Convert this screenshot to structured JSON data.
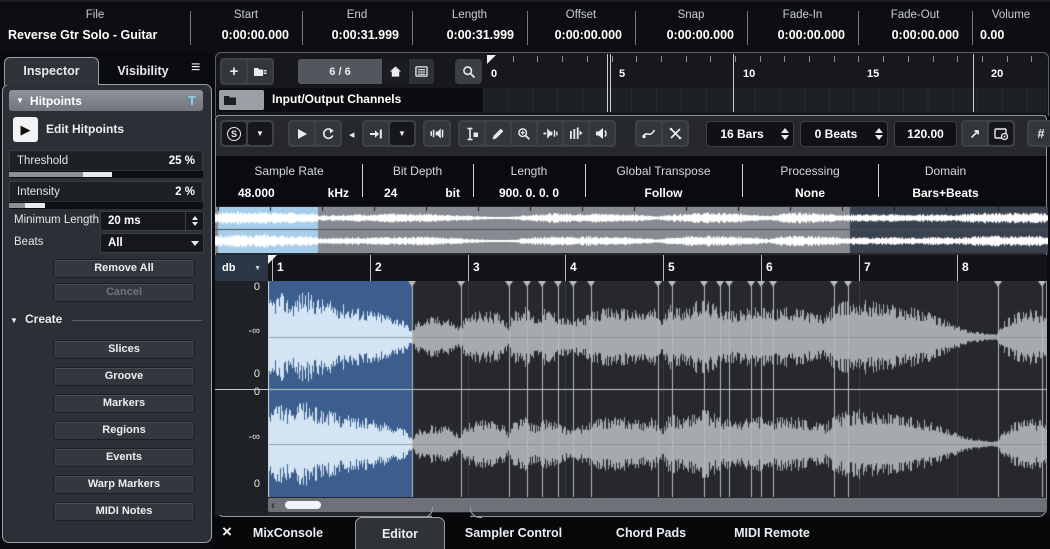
{
  "info_bar": {
    "columns": [
      {
        "label": "File",
        "value": "Reverse Gtr Solo - Guitar"
      },
      {
        "label": "Start",
        "value": "0:00:00.000"
      },
      {
        "label": "End",
        "value": "0:00:31.999"
      },
      {
        "label": "Length",
        "value": "0:00:31.999"
      },
      {
        "label": "Offset",
        "value": "0:00:00.000"
      },
      {
        "label": "Snap",
        "value": "0:00:00.000"
      },
      {
        "label": "Fade-In",
        "value": "0:00:00.000"
      },
      {
        "label": "Fade-Out",
        "value": "0:00:00.000"
      },
      {
        "label": "Volume",
        "value": "0.00"
      }
    ]
  },
  "sidebar": {
    "tabs": [
      {
        "label": "Inspector",
        "active": true
      },
      {
        "label": "Visibility",
        "active": false
      }
    ],
    "menu_icon": "≡",
    "hitpoints": {
      "collapse_icon": "▼",
      "title": "Hitpoints",
      "tool_badge": "T",
      "edit_icon": "▶",
      "edit_label": "Edit Hitpoints",
      "threshold_label": "Threshold",
      "threshold_value": "25 %",
      "threshold_fill": 0.38,
      "intensity_label": "Intensity",
      "intensity_value": "2 %",
      "intensity_fill": 0.08,
      "minimum_length_label": "Minimum Length",
      "minimum_length_value": "20 ms",
      "beats_label": "Beats",
      "beats_value": "All",
      "remove_all_label": "Remove All",
      "cancel_label": "Cancel"
    },
    "create": {
      "collapse_icon": "▼",
      "title": "Create",
      "buttons": [
        "Slices",
        "Groove",
        "Markers",
        "Regions",
        "Events",
        "Warp Markers",
        "MIDI Notes"
      ]
    }
  },
  "project_zone": {
    "track_counter": "6 / 6",
    "track_name": "Input/Output Channels",
    "ruler_ticks": [
      "0",
      "5",
      "10",
      "15",
      "20"
    ]
  },
  "editor": {
    "toolbar": {
      "solo_icon": "S",
      "dropdown_icon": "▼",
      "tiny_left_icon": "◀",
      "bars": "16 Bars",
      "beats": "0 Beats",
      "tempo": "120.00",
      "export_icon": "↗",
      "grid_icon": "#"
    },
    "info": [
      {
        "label": "Sample Rate",
        "value": "48.000",
        "unit": "kHz"
      },
      {
        "label": "Bit Depth",
        "value": "24",
        "unit": "bit"
      },
      {
        "label": "Length",
        "value": "900. 0. 0.  0",
        "unit": ""
      },
      {
        "label": "Global Transpose",
        "value": "Follow",
        "unit": ""
      },
      {
        "label": "Processing",
        "value": "None",
        "unit": ""
      },
      {
        "label": "Domain",
        "value": "Bars+Beats",
        "unit": ""
      }
    ],
    "scale": {
      "unit": "db",
      "dropdown_icon": "▼",
      "ch1": [
        "0",
        "-∞",
        "0"
      ],
      "ch2": [
        "0",
        "-∞",
        "0"
      ]
    },
    "bar_numbers": [
      "1",
      "2",
      "3",
      "4",
      "5",
      "6",
      "7",
      "8"
    ]
  },
  "waveform": {
    "selection_fraction": 0.185,
    "hitpoints": [
      0.185,
      0.248,
      0.31,
      0.332,
      0.352,
      0.372,
      0.392,
      0.415,
      0.5,
      0.518,
      0.56,
      0.58,
      0.592,
      0.62,
      0.633,
      0.648,
      0.726,
      0.745,
      0.937,
      0.994
    ],
    "main_envelope": [
      [
        0,
        0.62
      ],
      [
        0.015,
        0.78
      ],
      [
        0.03,
        0.62
      ],
      [
        0.045,
        0.82
      ],
      [
        0.06,
        0.7
      ],
      [
        0.08,
        0.62
      ],
      [
        0.1,
        0.56
      ],
      [
        0.12,
        0.5
      ],
      [
        0.14,
        0.44
      ],
      [
        0.16,
        0.38
      ],
      [
        0.175,
        0.28
      ],
      [
        0.185,
        0.1
      ],
      [
        0.19,
        0.28
      ],
      [
        0.21,
        0.36
      ],
      [
        0.23,
        0.34
      ],
      [
        0.245,
        0.18
      ],
      [
        0.255,
        0.38
      ],
      [
        0.27,
        0.46
      ],
      [
        0.285,
        0.44
      ],
      [
        0.3,
        0.42
      ],
      [
        0.308,
        0.2
      ],
      [
        0.315,
        0.46
      ],
      [
        0.33,
        0.52
      ],
      [
        0.345,
        0.34
      ],
      [
        0.355,
        0.5
      ],
      [
        0.365,
        0.46
      ],
      [
        0.38,
        0.34
      ],
      [
        0.39,
        0.3
      ],
      [
        0.4,
        0.34
      ],
      [
        0.42,
        0.46
      ],
      [
        0.44,
        0.52
      ],
      [
        0.46,
        0.5
      ],
      [
        0.48,
        0.44
      ],
      [
        0.495,
        0.52
      ],
      [
        0.505,
        0.3
      ],
      [
        0.515,
        0.56
      ],
      [
        0.53,
        0.52
      ],
      [
        0.545,
        0.6
      ],
      [
        0.56,
        0.66
      ],
      [
        0.575,
        0.56
      ],
      [
        0.59,
        0.48
      ],
      [
        0.6,
        0.44
      ],
      [
        0.615,
        0.5
      ],
      [
        0.63,
        0.52
      ],
      [
        0.645,
        0.48
      ],
      [
        0.66,
        0.52
      ],
      [
        0.68,
        0.5
      ],
      [
        0.7,
        0.44
      ],
      [
        0.715,
        0.36
      ],
      [
        0.725,
        0.56
      ],
      [
        0.74,
        0.62
      ],
      [
        0.76,
        0.66
      ],
      [
        0.78,
        0.62
      ],
      [
        0.8,
        0.58
      ],
      [
        0.82,
        0.54
      ],
      [
        0.84,
        0.48
      ],
      [
        0.86,
        0.36
      ],
      [
        0.88,
        0.22
      ],
      [
        0.9,
        0.12
      ],
      [
        0.92,
        0.07
      ],
      [
        0.935,
        0.05
      ],
      [
        0.945,
        0.28
      ],
      [
        0.96,
        0.42
      ],
      [
        0.98,
        0.48
      ],
      [
        1,
        0.42
      ]
    ],
    "overview": {
      "selection_start": 0.004,
      "selection_end": 0.124,
      "visible_region_end": 0.762,
      "envelope": [
        [
          0,
          0.5
        ],
        [
          0.02,
          0.62
        ],
        [
          0.04,
          0.55
        ],
        [
          0.06,
          0.6
        ],
        [
          0.08,
          0.52
        ],
        [
          0.1,
          0.48
        ],
        [
          0.12,
          0.42
        ],
        [
          0.125,
          0.25
        ],
        [
          0.15,
          0.32
        ],
        [
          0.17,
          0.38
        ],
        [
          0.19,
          0.33
        ],
        [
          0.21,
          0.42
        ],
        [
          0.23,
          0.38
        ],
        [
          0.25,
          0.42
        ],
        [
          0.27,
          0.36
        ],
        [
          0.29,
          0.28
        ],
        [
          0.31,
          0.2
        ],
        [
          0.33,
          0.12
        ],
        [
          0.35,
          0.08
        ],
        [
          0.37,
          0.26
        ],
        [
          0.39,
          0.4
        ],
        [
          0.41,
          0.46
        ],
        [
          0.43,
          0.4
        ],
        [
          0.45,
          0.44
        ],
        [
          0.47,
          0.42
        ],
        [
          0.49,
          0.38
        ],
        [
          0.51,
          0.3
        ],
        [
          0.53,
          0.18
        ],
        [
          0.55,
          0.36
        ],
        [
          0.57,
          0.46
        ],
        [
          0.59,
          0.5
        ],
        [
          0.61,
          0.46
        ],
        [
          0.63,
          0.42
        ],
        [
          0.65,
          0.36
        ],
        [
          0.665,
          0.2
        ],
        [
          0.68,
          0.44
        ],
        [
          0.7,
          0.5
        ],
        [
          0.72,
          0.46
        ],
        [
          0.74,
          0.4
        ],
        [
          0.755,
          0.3
        ],
        [
          0.77,
          0.38
        ],
        [
          0.79,
          0.32
        ],
        [
          0.81,
          0.38
        ],
        [
          0.83,
          0.3
        ],
        [
          0.85,
          0.34
        ],
        [
          0.87,
          0.38
        ],
        [
          0.89,
          0.32
        ],
        [
          0.91,
          0.44
        ],
        [
          0.93,
          0.5
        ],
        [
          0.95,
          0.46
        ],
        [
          0.97,
          0.5
        ],
        [
          1,
          0.44
        ]
      ]
    },
    "colors": {
      "selection_bg": "#3b5e8e",
      "selection_wave": "#d3e5f4",
      "wave": "#a6aaae",
      "overview_bg_visible": "#868b91",
      "overview_bg_rest": "#3a4250",
      "overview_selection_bg": "#a6cdea",
      "overview_wave": "#ffffff",
      "hitpoint_line": "#b6b9bd",
      "bar_gridline": "#3a3d42"
    }
  },
  "bottom_bar": {
    "close_icon": "×",
    "tabs": [
      {
        "label": "MixConsole",
        "active": false
      },
      {
        "label": "Editor",
        "active": true
      },
      {
        "label": "Sampler Control",
        "active": false
      },
      {
        "label": "Chord Pads",
        "active": false
      },
      {
        "label": "MIDI Remote",
        "active": false
      }
    ]
  },
  "icons": {
    "menu": "≡",
    "stepper_up": "▲",
    "stepper_down": "▼",
    "scroll_left": "‹",
    "infinity": "-∞"
  }
}
